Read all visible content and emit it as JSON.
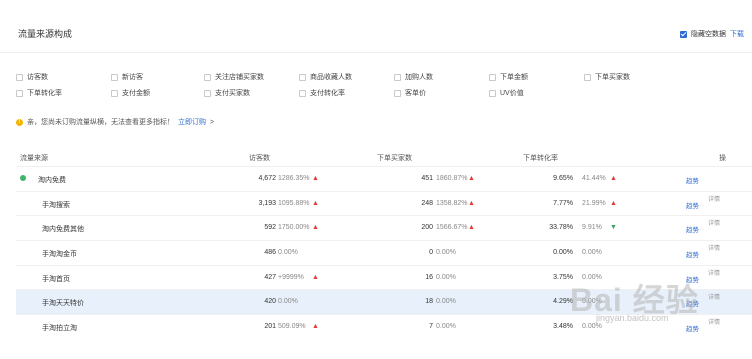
{
  "header": {
    "title": "流量来源构成",
    "hide_empty_label": "隐藏空数据",
    "download_label": "下载",
    "accent_color": "#2d6bd3"
  },
  "metrics": [
    {
      "label": "访客数",
      "checked": true
    },
    {
      "label": "新访客",
      "checked": false
    },
    {
      "label": "关注店铺买家数",
      "checked": false
    },
    {
      "label": "商品收藏人数",
      "checked": false
    },
    {
      "label": "加购人数",
      "checked": false
    },
    {
      "label": "下单金额",
      "checked": false
    },
    {
      "label": "下单买家数",
      "checked": true
    },
    {
      "label": "下单转化率",
      "checked": true
    },
    {
      "label": "支付金额",
      "checked": false
    },
    {
      "label": "支付买家数",
      "checked": false
    },
    {
      "label": "支付转化率",
      "checked": false
    },
    {
      "label": "客单价",
      "checked": false
    },
    {
      "label": "UV价值",
      "checked": false
    }
  ],
  "notice": {
    "text": "亲，您尚未订购流量纵横，无法查看更多指标！",
    "link": "立即订购",
    "arrow": ">"
  },
  "table": {
    "columns": [
      "流量来源",
      "访客数",
      "下单买家数",
      "下单转化率",
      "操"
    ],
    "rows": [
      {
        "source": "淘内免费",
        "visitors": "4,672",
        "visitors_pct": "1286.35%",
        "visitors_trend": "up",
        "buyers": "451",
        "buyers_pct": "1860.87%",
        "buyers_trend": "up",
        "rate": "9.65%",
        "rate_pct": "41.44%",
        "rate_trend": "up",
        "action": "趋势",
        "detail": ""
      },
      {
        "source": "手淘搜索",
        "visitors": "3,193",
        "visitors_pct": "1095.88%",
        "visitors_trend": "up",
        "buyers": "248",
        "buyers_pct": "1358.82%",
        "buyers_trend": "up",
        "rate": "7.77%",
        "rate_pct": "21.99%",
        "rate_trend": "up",
        "action": "趋势",
        "detail": "详情"
      },
      {
        "source": "淘内免费其他",
        "visitors": "592",
        "visitors_pct": "1750.00%",
        "visitors_trend": "up",
        "buyers": "200",
        "buyers_pct": "1566.67%",
        "buyers_trend": "up",
        "rate": "33.78%",
        "rate_pct": "9.91%",
        "rate_trend": "down",
        "action": "趋势",
        "detail": "详情"
      },
      {
        "source": "手淘淘金币",
        "visitors": "486",
        "visitors_pct": "0.00%",
        "visitors_trend": "",
        "buyers": "0",
        "buyers_pct": "0.00%",
        "buyers_trend": "",
        "rate": "0.00%",
        "rate_pct": "0.00%",
        "rate_trend": "",
        "action": "趋势",
        "detail": "详情"
      },
      {
        "source": "手淘首页",
        "visitors": "427",
        "visitors_pct": "+9999%",
        "visitors_trend": "up",
        "buyers": "16",
        "buyers_pct": "0.00%",
        "buyers_trend": "",
        "rate": "3.75%",
        "rate_pct": "0.00%",
        "rate_trend": "",
        "action": "趋势",
        "detail": "详情"
      },
      {
        "source": "手淘天天特价",
        "visitors": "420",
        "visitors_pct": "0.00%",
        "visitors_trend": "",
        "buyers": "18",
        "buyers_pct": "0.00%",
        "buyers_trend": "",
        "rate": "4.29%",
        "rate_pct": "0.00%",
        "rate_trend": "",
        "action": "趋势",
        "detail": "详情"
      },
      {
        "source": "手淘拍立淘",
        "visitors": "201",
        "visitors_pct": "509.09%",
        "visitors_trend": "up",
        "buyers": "7",
        "buyers_pct": "0.00%",
        "buyers_trend": "",
        "rate": "3.48%",
        "rate_pct": "0.00%",
        "rate_trend": "",
        "action": "趋势",
        "detail": "详情"
      }
    ]
  },
  "watermark": {
    "main": "Bai 经验",
    "sub": "jingyan.baidu.com"
  }
}
